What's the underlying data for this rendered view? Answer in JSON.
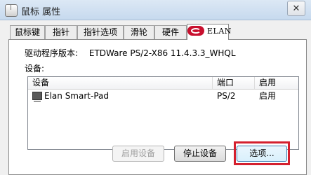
{
  "window": {
    "title": "鼠标 属性",
    "close_label": "✕"
  },
  "tabs": [
    {
      "label": "鼠标键"
    },
    {
      "label": "指针"
    },
    {
      "label": "指针选项"
    },
    {
      "label": "滑轮"
    },
    {
      "label": "硬件"
    },
    {
      "label": "ELAN",
      "icon": "elan-logo-icon"
    }
  ],
  "elan": {
    "driver_version_label": "驱动程序版本:",
    "driver_version_value": "ETDWare PS/2-X86 11.4.3.3_WHQL",
    "devices_label": "设备:",
    "columns": [
      "设备",
      "端口",
      "启用"
    ],
    "devices": [
      {
        "name": "Elan Smart-Pad",
        "port": "PS/2",
        "enabled": "启用",
        "icon": "touchpad-device-icon"
      }
    ]
  },
  "buttons": {
    "enable_device": "启用设备",
    "stop_device": "停止设备",
    "options": "选项..."
  },
  "colors": {
    "highlight": "#d4202e",
    "elan_brand": "#c8102e"
  }
}
